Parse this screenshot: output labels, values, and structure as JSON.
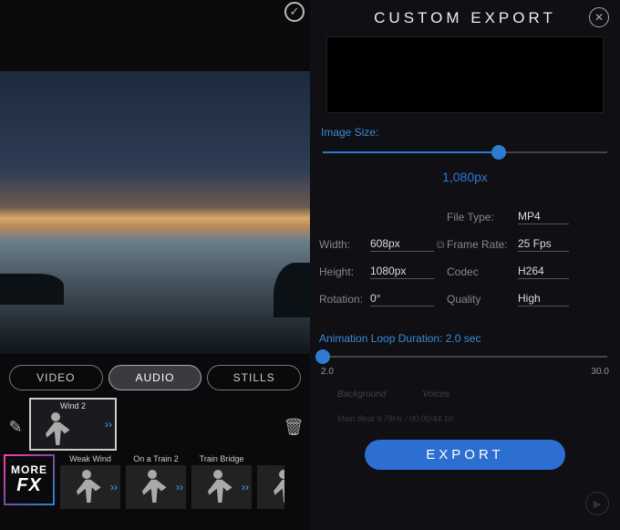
{
  "left": {
    "tabs": {
      "video": "VIDEO",
      "audio": "AUDIO",
      "stills": "STILLS"
    },
    "selected_clip": "Wind 2",
    "thumbs": [
      "Weak Wind",
      "On a Train 2",
      "Train Bridge"
    ],
    "morefx_top": "MORE",
    "morefx_bottom": "FX"
  },
  "right": {
    "title": "CUSTOM  EXPORT",
    "image_size_label": "Image Size:",
    "image_size_value": "1,080px",
    "image_size_pct": 62,
    "width_label": "Width:",
    "width_value": "608px",
    "height_label": "Height:",
    "height_value": "1080px",
    "rotation_label": "Rotation:",
    "rotation_value": "0°",
    "filetype_label": "File Type:",
    "filetype_value": "MP4",
    "framerate_label": "Frame Rate:",
    "framerate_value": "25 Fps",
    "codec_label": "Codec",
    "codec_value": "H264",
    "quality_label": "Quality",
    "quality_value": "High",
    "loop_label": "Animation Loop Duration:",
    "loop_value": "2.0 sec",
    "loop_min": "2.0",
    "loop_max": "30.0",
    "ghost_bg": "Background",
    "ghost_voices": "Voices",
    "ghost_beat": "Main Beat 9.79Hs / 00:00/44.10",
    "export_btn": "EXPORT"
  }
}
